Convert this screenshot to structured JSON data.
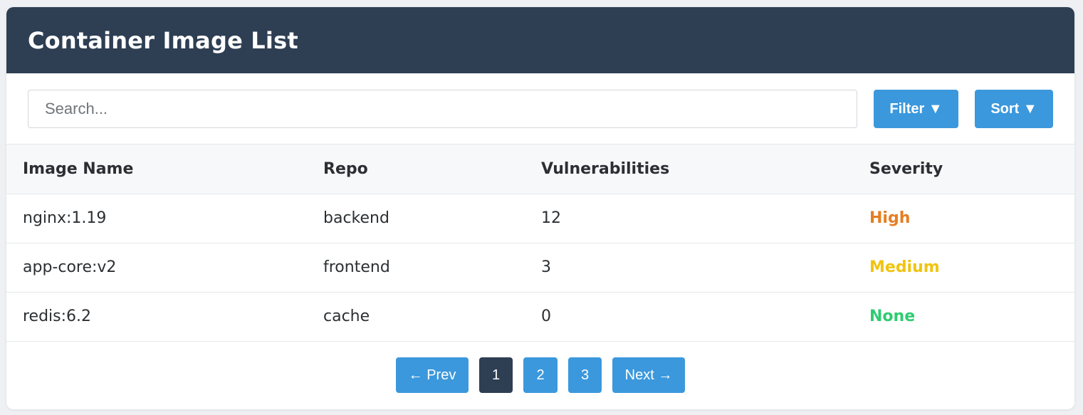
{
  "header": {
    "title": "Container Image List"
  },
  "toolbar": {
    "search_placeholder": "Search...",
    "filter_label": "Filter ▼",
    "sort_label": "Sort ▼"
  },
  "table": {
    "columns": [
      "Image Name",
      "Repo",
      "Vulnerabilities",
      "Severity"
    ],
    "rows": [
      {
        "image": "nginx:1.19",
        "repo": "backend",
        "vulns": "12",
        "severity": "High",
        "severity_color": "#e67e22"
      },
      {
        "image": "app-core:v2",
        "repo": "frontend",
        "vulns": "3",
        "severity": "Medium",
        "severity_color": "#f1c40f"
      },
      {
        "image": "redis:6.2",
        "repo": "cache",
        "vulns": "0",
        "severity": "None",
        "severity_color": "#2ecc71"
      }
    ]
  },
  "pagination": {
    "prev_label": "← Prev",
    "pages": [
      "1",
      "2",
      "3"
    ],
    "current_page": "1",
    "next_label": "Next →"
  },
  "colors": {
    "header_bg": "#2e3e53",
    "accent": "#3b98dc",
    "active_page": "#2e3e53"
  }
}
